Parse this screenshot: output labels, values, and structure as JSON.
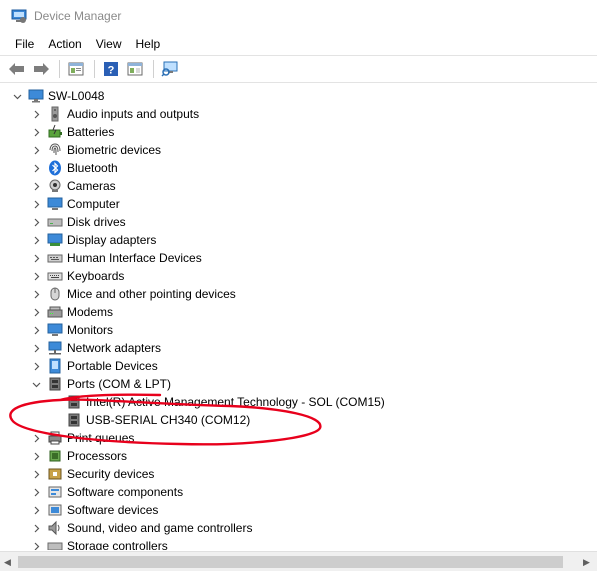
{
  "window": {
    "title": "Device Manager"
  },
  "menu": {
    "items": [
      "File",
      "Action",
      "View",
      "Help"
    ]
  },
  "toolbar": {
    "buttons": [
      "back-icon",
      "forward-icon",
      "properties-icon",
      "help-icon",
      "show-hidden-icon",
      "scan-hardware-icon"
    ]
  },
  "tree": {
    "root": "SW-L0048",
    "categories": [
      "Audio inputs and outputs",
      "Batteries",
      "Biometric devices",
      "Bluetooth",
      "Cameras",
      "Computer",
      "Disk drives",
      "Display adapters",
      "Human Interface Devices",
      "Keyboards",
      "Mice and other pointing devices",
      "Modems",
      "Monitors",
      "Network adapters",
      "Portable Devices",
      "Ports (COM & LPT)",
      "Print queues",
      "Processors",
      "Security devices",
      "Software components",
      "Software devices",
      "Sound, video and game controllers",
      "Storage controllers"
    ],
    "ports_children": [
      "Intel(R) Active Management Technology - SOL (COM15)",
      "USB-SERIAL CH340 (COM12)"
    ]
  },
  "colors": {
    "annotation": "#e8001c",
    "title_text": "#8a8a8a",
    "accent_blue": "#1e6fd9"
  }
}
